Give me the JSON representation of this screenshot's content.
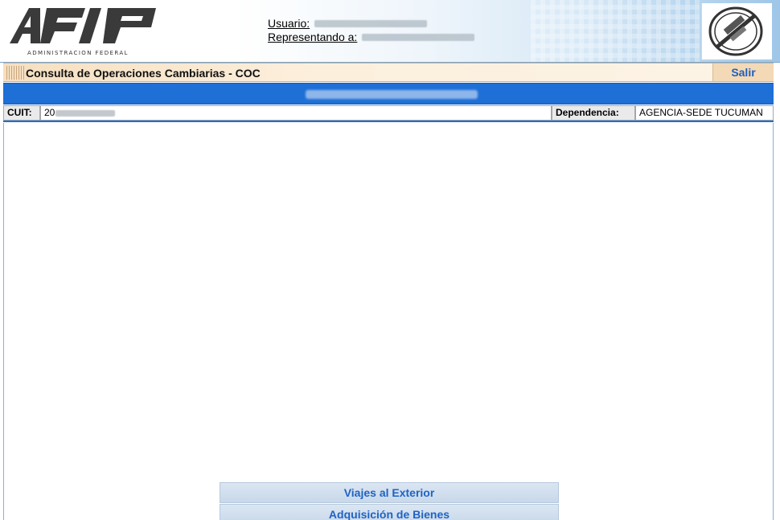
{
  "header": {
    "logo_text": "AFIP",
    "logo_caption": "ADMINISTRACION FEDERAL",
    "user_label": "Usuario:",
    "represent_label": "Representando a:",
    "seal_icon": "afip-seal-icon"
  },
  "title_bar": {
    "title": "Consulta de Operaciones Cambiarias - COC",
    "exit_label": "Salir"
  },
  "info": {
    "cuit_label": "CUIT:",
    "cuit_prefix": "20",
    "dependency_label": "Dependencia:",
    "dependency_value": "AGENCIA-SEDE TUCUMAN"
  },
  "menu": {
    "items": [
      {
        "label": "Viajes al Exterior"
      },
      {
        "label": "Adquisición de Bienes"
      }
    ]
  },
  "colors": {
    "accent_blue": "#1e6fd6",
    "title_bar_bg": "#fcefdc",
    "link_blue": "#1f63c4"
  }
}
